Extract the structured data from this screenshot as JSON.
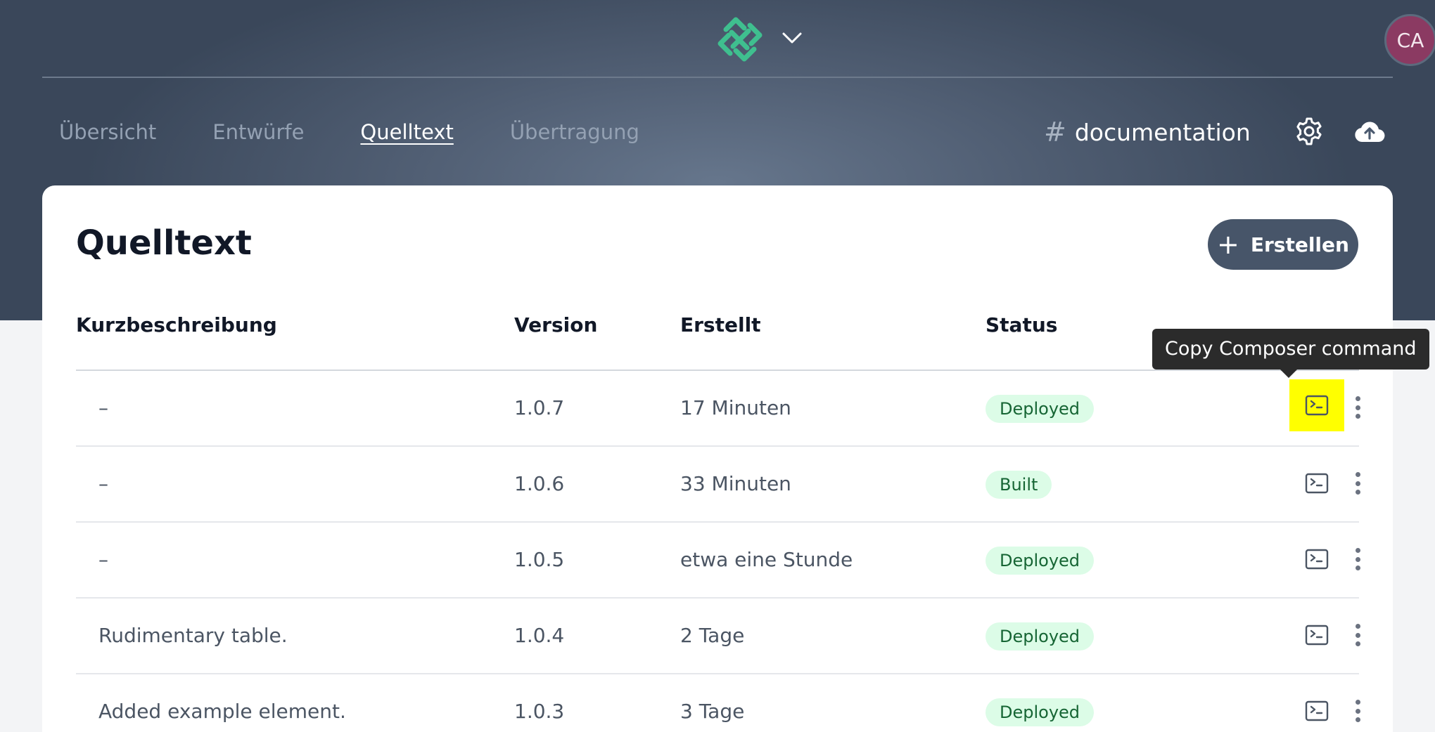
{
  "header": {
    "avatar_initials": "CA",
    "logo_icon": "interlocking-logo-icon",
    "logo_color": "#3fbf8f"
  },
  "nav": {
    "items": [
      {
        "label": "Übersicht",
        "active": false
      },
      {
        "label": "Entwürfe",
        "active": false
      },
      {
        "label": "Quelltext",
        "active": true
      },
      {
        "label": "Übertragung",
        "active": false
      }
    ],
    "project_prefix": "#",
    "project_name": "documentation"
  },
  "page": {
    "title": "Quelltext",
    "create_label": "Erstellen"
  },
  "table": {
    "columns": [
      "Kurzbeschreibung",
      "Version",
      "Erstellt",
      "Status"
    ],
    "rows": [
      {
        "description": "–",
        "version": "1.0.7",
        "created": "17 Minuten",
        "status": "Deployed"
      },
      {
        "description": "–",
        "version": "1.0.6",
        "created": "33 Minuten",
        "status": "Built"
      },
      {
        "description": "–",
        "version": "1.0.5",
        "created": "etwa eine Stunde",
        "status": "Deployed"
      },
      {
        "description": "Rudimentary table.",
        "version": "1.0.4",
        "created": "2 Tage",
        "status": "Deployed"
      },
      {
        "description": "Added example element.",
        "version": "1.0.3",
        "created": "3 Tage",
        "status": "Deployed"
      }
    ]
  },
  "tooltip": {
    "text": "Copy Composer command"
  },
  "colors": {
    "badge_bg": "#dcfce7",
    "badge_text": "#166534",
    "create_button": "#475569",
    "highlight": "#ffff00",
    "avatar": "#8b3a62"
  }
}
